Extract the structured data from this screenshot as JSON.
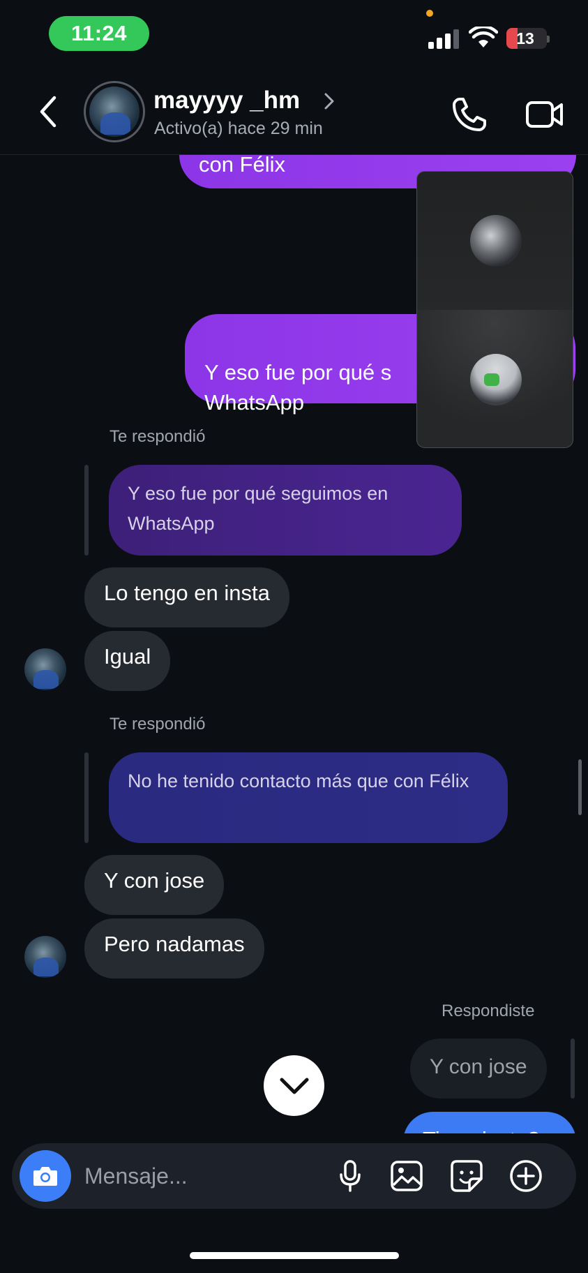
{
  "status_bar": {
    "time": "11:24",
    "battery": "13"
  },
  "header": {
    "username": "mayyyy _hm",
    "activity": "Activo(a) hace 29 min"
  },
  "messages": {
    "top_partial": "con Félix",
    "sent_whatsapp": "Y eso fue por qué s\nWhatsApp",
    "reply_label_1": "Te respondió",
    "quote_1": "Y eso fue por qué seguimos en WhatsApp",
    "in_1": "Lo tengo en insta",
    "in_2": "Igual",
    "reply_label_2": "Te respondió",
    "quote_2": "No he tenido contacto más que con Félix",
    "in_3": "Y con jose",
    "in_4": "Pero nadamas",
    "reply_label_3": "Respondiste",
    "quote_3": "Y con jose",
    "sent_last": "Tiene insta?"
  },
  "composer": {
    "placeholder": "Mensaje..."
  },
  "colors": {
    "accent_blue": "#3c7bf4",
    "sent_purple": "#9b40f0",
    "status_green": "#34c759",
    "battery_red": "#e5484d"
  },
  "icons": [
    "back-icon",
    "chevron-right-icon",
    "phone-icon",
    "video-camera-icon",
    "chevron-down-icon",
    "camera-icon",
    "microphone-icon",
    "gallery-icon",
    "sticker-icon",
    "plus-circle-icon"
  ]
}
